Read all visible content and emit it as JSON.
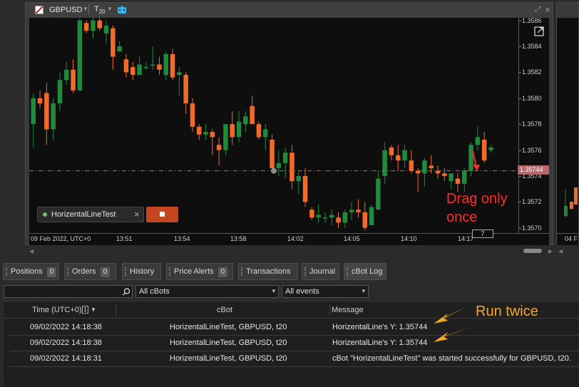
{
  "chart": {
    "symbol": "GBPUSD",
    "timeframe_main": "T",
    "timeframe_sub": "20",
    "price_levels": [
      "1.3586",
      "1.3584",
      "1.3582",
      "1.3580",
      "1.3578",
      "1.3576",
      "1.3574",
      "1.3572",
      "1.3570"
    ],
    "current_price": "1.35744",
    "time_labels": [
      "09 Feb 2022, UTC+0",
      "13:51",
      "13:54",
      "13:58",
      "14:02",
      "14:05",
      "14:10",
      "14:17"
    ],
    "bar_count": "7",
    "cbot_name": "HorizentalLineTest",
    "up_color": "#1f8a3c",
    "down_color": "#f06a2a",
    "line_color": "#b5696a"
  },
  "annotations": {
    "drag_note_line1": "Drag only",
    "drag_note_line2": "once",
    "run_note": "Run twice",
    "red_color": "#ff2a2a",
    "orange_color": "#f5a623"
  },
  "right_window": {
    "time_label": "04 F"
  },
  "tabs": [
    {
      "label": "Positions",
      "count": "0"
    },
    {
      "label": "Orders",
      "count": "0"
    },
    {
      "label": "History"
    },
    {
      "label": "Price Alerts",
      "count": "0"
    },
    {
      "label": "Transactions"
    },
    {
      "label": "Journal"
    },
    {
      "label": "cBot Log"
    }
  ],
  "filters": {
    "search_value": "",
    "cbot_filter": "All cBots",
    "event_filter": "All events"
  },
  "log_table": {
    "headers": {
      "time": "Time (UTC+0)",
      "sort_index": "1",
      "cbot": "cBot",
      "message": "Message"
    },
    "rows": [
      {
        "time": "09/02/2022 14:18:38",
        "cbot": "HorizentalLineTest, GBPUSD, t20",
        "message": "HorizentalLine's Y: 1.35744"
      },
      {
        "time": "09/02/2022 14:18:38",
        "cbot": "HorizentalLineTest, GBPUSD, t20",
        "message": "HorizentalLine's Y: 1.35744"
      },
      {
        "time": "09/02/2022 14:18:31",
        "cbot": "HorizentalLineTest, GBPUSD, t20",
        "message": "cBot \"HorizentalLineTest\" was started successfully for GBPUSD, t20."
      }
    ]
  },
  "candles": [
    [
      1.3578,
      1.35804,
      1.35762,
      1.358
    ],
    [
      1.358,
      1.35806,
      1.35792,
      1.35796
    ],
    [
      1.35804,
      1.35812,
      1.35764,
      1.35776
    ],
    [
      1.35776,
      1.358,
      1.35768,
      1.35796
    ],
    [
      1.35796,
      1.3582,
      1.3579,
      1.35814
    ],
    [
      1.35814,
      1.35828,
      1.3581,
      1.35822
    ],
    [
      1.35822,
      1.3583,
      1.35804,
      1.35806
    ],
    [
      1.35806,
      1.35862,
      1.35806,
      1.3586
    ],
    [
      1.35858,
      1.3586,
      1.3585,
      1.35852
    ],
    [
      1.35852,
      1.35864,
      1.35846,
      1.3586
    ],
    [
      1.3586,
      1.35866,
      1.35852,
      1.35854
    ],
    [
      1.3585,
      1.3586,
      1.35842,
      1.35856
    ],
    [
      1.35854,
      1.35856,
      1.35822,
      1.35832
    ],
    [
      1.35836,
      1.35844,
      1.35836,
      1.3584
    ],
    [
      1.3583,
      1.35834,
      1.35816,
      1.3582
    ],
    [
      1.35824,
      1.35828,
      1.35814,
      1.35818
    ],
    [
      1.35818,
      1.35832,
      1.35818,
      1.35826
    ],
    [
      1.35824,
      1.35828,
      1.35822,
      1.35824
    ],
    [
      1.35826,
      1.3584,
      1.35822,
      1.35826
    ],
    [
      1.35826,
      1.35832,
      1.35818,
      1.35822
    ],
    [
      1.35818,
      1.35836,
      1.35814,
      1.35834
    ],
    [
      1.35834,
      1.35838,
      1.35814,
      1.35816
    ],
    [
      1.35818,
      1.35824,
      1.35802,
      1.3582
    ],
    [
      1.35818,
      1.3582,
      1.35788,
      1.35796
    ],
    [
      1.35796,
      1.358,
      1.35774,
      1.35778
    ],
    [
      1.35778,
      1.3578,
      1.35768,
      1.35772
    ],
    [
      1.35772,
      1.3578,
      1.35768,
      1.35774
    ],
    [
      1.35774,
      1.35776,
      1.35756,
      1.3577
    ],
    [
      1.35764,
      1.3577,
      1.35748,
      1.3576
    ],
    [
      1.3576,
      1.3578,
      1.35756,
      1.3578
    ],
    [
      1.3578,
      1.3579,
      1.35764,
      1.3577
    ],
    [
      1.3577,
      1.3579,
      1.35766,
      1.35782
    ],
    [
      1.3578,
      1.3579,
      1.35774,
      1.35786
    ],
    [
      1.35794,
      1.35802,
      1.35782,
      1.3578
    ],
    [
      1.3578,
      1.35782,
      1.35768,
      1.3577
    ],
    [
      1.3577,
      1.3578,
      1.3576,
      1.35776
    ],
    [
      1.35768,
      1.35772,
      1.35744,
      1.35746
    ],
    [
      1.35746,
      1.3576,
      1.3574,
      1.3575
    ],
    [
      1.3575,
      1.35762,
      1.35738,
      1.35758
    ],
    [
      1.35758,
      1.35764,
      1.3573,
      1.35736
    ],
    [
      1.35736,
      1.35744,
      1.35726,
      1.3574
    ],
    [
      1.3574,
      1.35746,
      1.35716,
      1.3572
    ],
    [
      1.35714,
      1.35716,
      1.35706,
      1.35708
    ],
    [
      1.35708,
      1.35718,
      1.35704,
      1.3571
    ],
    [
      1.35708,
      1.35712,
      1.35704,
      1.35708
    ],
    [
      1.35708,
      1.35714,
      1.35702,
      1.3571
    ],
    [
      1.35708,
      1.35712,
      1.357,
      1.35704
    ],
    [
      1.35704,
      1.35714,
      1.357,
      1.35712
    ],
    [
      1.35712,
      1.3572,
      1.35706,
      1.35714
    ],
    [
      1.35714,
      1.35722,
      1.35708,
      1.35712
    ],
    [
      1.35712,
      1.3572,
      1.35698,
      1.357
    ],
    [
      1.35702,
      1.35718,
      1.35702,
      1.35716
    ],
    [
      1.35714,
      1.35744,
      1.35714,
      1.35738
    ],
    [
      1.3574,
      1.35766,
      1.35734,
      1.3576
    ],
    [
      1.35762,
      1.35764,
      1.35752,
      1.35756
    ],
    [
      1.35756,
      1.35764,
      1.35744,
      1.35752
    ],
    [
      1.35752,
      1.35764,
      1.35746,
      1.3576
    ],
    [
      1.35752,
      1.3576,
      1.35742,
      1.35744
    ],
    [
      1.35744,
      1.35746,
      1.35728,
      1.35742
    ],
    [
      1.35742,
      1.35754,
      1.35732,
      1.35752
    ],
    [
      1.35748,
      1.35756,
      1.35742,
      1.35746
    ],
    [
      1.35744,
      1.35748,
      1.35738,
      1.35742
    ],
    [
      1.35742,
      1.35746,
      1.35736,
      1.3574
    ],
    [
      1.35736,
      1.35742,
      1.3573,
      1.35742
    ],
    [
      1.35738,
      1.35742,
      1.35728,
      1.35734
    ],
    [
      1.35734,
      1.35746,
      1.35728,
      1.35744
    ],
    [
      1.35744,
      1.35766,
      1.3574,
      1.35764
    ],
    [
      1.35764,
      1.35778,
      1.3576,
      1.3577
    ],
    [
      1.35768,
      1.35774,
      1.3575,
      1.35752
    ],
    [
      1.3576,
      1.35764,
      1.35758,
      1.35762
    ]
  ]
}
